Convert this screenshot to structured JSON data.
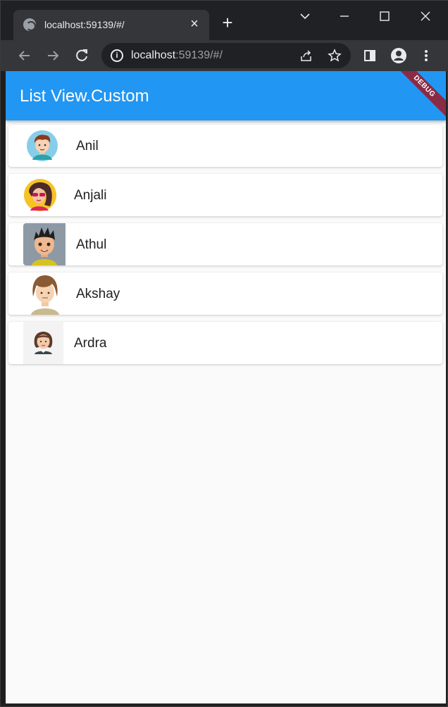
{
  "browser": {
    "tab_title": "localhost:59139/#/",
    "url_host": "localhost",
    "url_rest": ":59139/#/"
  },
  "app": {
    "title": "List View.Custom",
    "debug_label": "DEBUG",
    "accent_color": "#2196f3"
  },
  "list": {
    "items": [
      {
        "name": "Anil",
        "avatar_icon": "boy-cartoon-avatar"
      },
      {
        "name": "Anjali",
        "avatar_icon": "girl-sunglasses-avatar"
      },
      {
        "name": "Athul",
        "avatar_icon": "boy-spiky-hair-3d-avatar"
      },
      {
        "name": "Akshay",
        "avatar_icon": "boy-long-hair-avatar"
      },
      {
        "name": "Ardra",
        "avatar_icon": "girl-short-hair-avatar"
      }
    ]
  }
}
